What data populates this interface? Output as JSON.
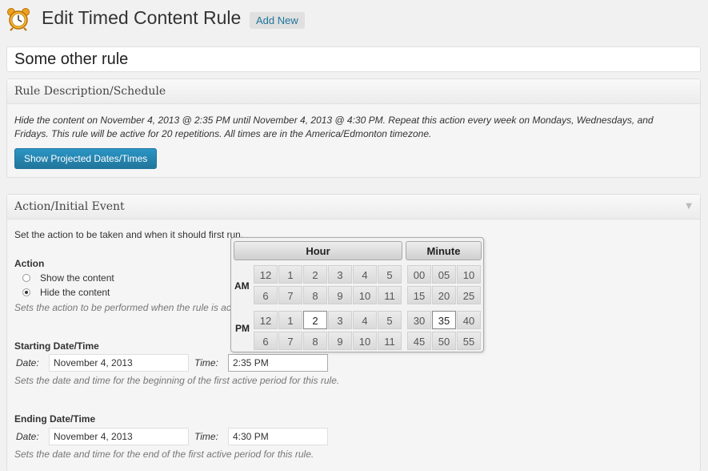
{
  "header": {
    "title": "Edit Timed Content Rule",
    "add_new": "Add New",
    "icon": "alarm-clock-icon"
  },
  "rule_title": "Some other rule",
  "description_box": {
    "heading": "Rule Description/Schedule",
    "line1": "Hide the content on November 4, 2013 @ 2:35 PM until November 4, 2013 @ 4:30 PM. Repeat this action every week on Mondays, Wednesdays, and",
    "line2": "Fridays. This rule will be active for 20 repetitions. All times are in the America/Edmonton timezone.",
    "button": "Show Projected Dates/Times"
  },
  "action_box": {
    "heading": "Action/Initial Event",
    "intro": "Set the action to be taken and when it should first run.",
    "action_label": "Action",
    "options": [
      {
        "label": "Show the content",
        "selected": false
      },
      {
        "label": "Hide the content",
        "selected": true
      }
    ],
    "action_hint": "Sets the action to be performed when the rule is active.",
    "start": {
      "label": "Starting Date/Time",
      "date_label": "Date:",
      "date": "November 4, 2013",
      "time_label": "Time:",
      "time": "2:35 PM",
      "hint": "Sets the date and time for the beginning of the first active period for this rule."
    },
    "end": {
      "label": "Ending Date/Time",
      "date_label": "Date:",
      "date": "November 4, 2013",
      "time_label": "Time:",
      "time": "4:30 PM",
      "hint": "Sets the date and time for the end of the first active period for this rule."
    }
  },
  "time_picker": {
    "hour_title": "Hour",
    "minute_title": "Minute",
    "am_label": "AM",
    "pm_label": "PM",
    "hour_rows": [
      [
        "12",
        "1",
        "2",
        "3",
        "4",
        "5"
      ],
      [
        "6",
        "7",
        "8",
        "9",
        "10",
        "11"
      ],
      [
        "12",
        "1",
        "2",
        "3",
        "4",
        "5"
      ],
      [
        "6",
        "7",
        "8",
        "9",
        "10",
        "11"
      ]
    ],
    "minute_rows": [
      [
        "00",
        "05",
        "10"
      ],
      [
        "15",
        "20",
        "25"
      ],
      [
        "30",
        "35",
        "40"
      ],
      [
        "45",
        "50",
        "55"
      ]
    ],
    "selected_hour": "2 PM",
    "selected_minute": "35"
  },
  "colors": {
    "accent": "#21759b",
    "link": "#21759b"
  }
}
